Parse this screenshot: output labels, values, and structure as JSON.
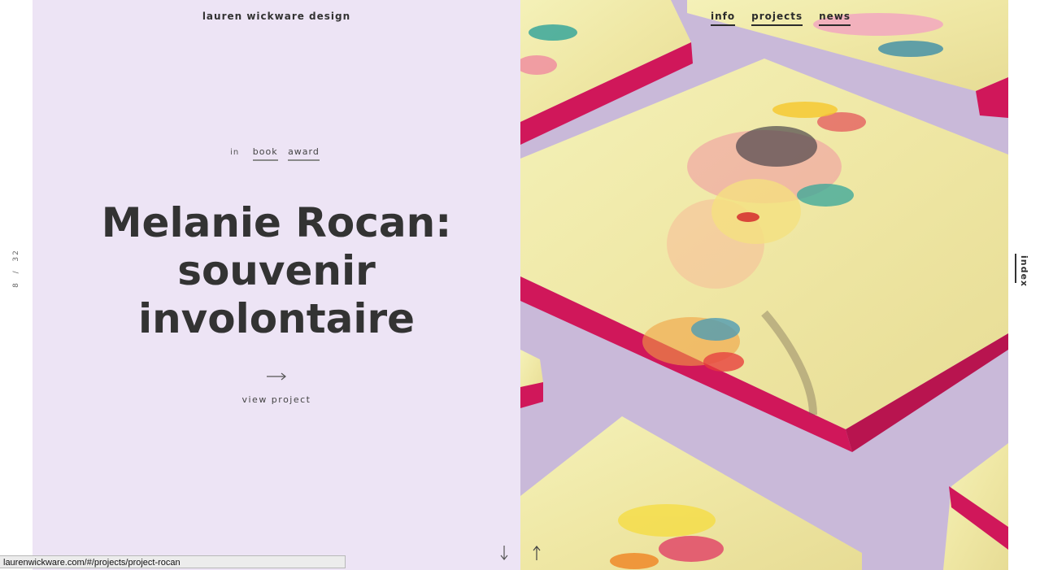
{
  "site": {
    "brand": "lauren wickware design"
  },
  "nav": {
    "items": [
      "info",
      "projects",
      "news"
    ]
  },
  "counter": {
    "current": "8",
    "separator": "/",
    "total": "32"
  },
  "project": {
    "in_label": "in",
    "tags": [
      "book",
      "award"
    ],
    "title_lines": [
      "Melanie Rocan:",
      "souvenir",
      "involontaire"
    ],
    "view_label": "view project"
  },
  "index_tab": {
    "label": "index"
  },
  "status_bar": {
    "url": "laurenwickware.com/#/projects/project-rocan"
  },
  "icons": {
    "view": "arrow-right-icon",
    "next": "arrow-down-icon",
    "prev": "arrow-up-icon"
  },
  "colors": {
    "panel": "#ede4f5",
    "backdrop": "#c9b9d9",
    "book_edge": "#d0175a",
    "text": "#333333"
  }
}
